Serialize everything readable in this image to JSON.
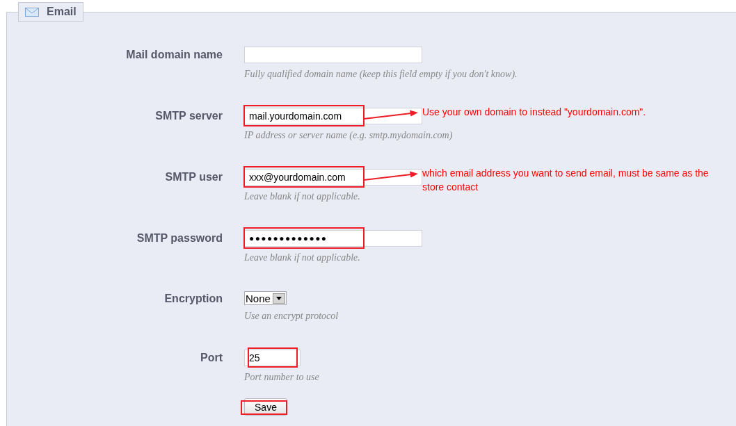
{
  "section": {
    "title": "Email"
  },
  "fields": [
    {
      "kind": "text",
      "label": "Mail domain name",
      "hint": "Fully qualified domain name (keep this field empty if you don't know).",
      "highlighted": false
    },
    {
      "kind": "text",
      "label": "SMTP server",
      "value": "mail.yourdomain.com",
      "hint": "IP address or server name (e.g. smtp.mydomain.com)",
      "highlighted": true,
      "note": "Use your own domain to instead \"yourdomain.com\"."
    },
    {
      "kind": "text",
      "label": "SMTP user",
      "value": "xxx@yourdomain.com",
      "hint": "Leave blank if not applicable.",
      "highlighted": true,
      "note": "which email address you want to send email, must be same as the store contact"
    },
    {
      "kind": "password",
      "label": "SMTP password",
      "value": "●●●●●●●●●●●●●",
      "hint": "Leave blank if not applicable.",
      "highlighted": true
    },
    {
      "kind": "select",
      "label": "Encryption",
      "value": "None",
      "hint": "Use an encrypt protocol",
      "highlighted": false
    },
    {
      "kind": "number",
      "label": "Port",
      "value": "25",
      "hint": "Port number to use",
      "highlighted": true
    }
  ],
  "save_button": {
    "label": "Save",
    "highlighted": true
  }
}
